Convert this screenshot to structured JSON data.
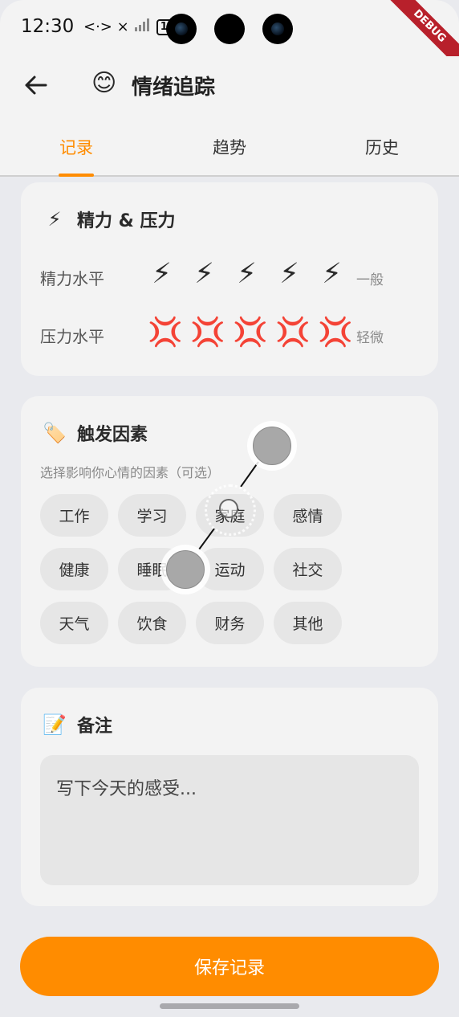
{
  "status_bar": {
    "time": "12:30",
    "network_icons": "<·> ×",
    "battery": "100"
  },
  "debug_banner": "DEBUG",
  "app_bar": {
    "title_emoji": "😊",
    "title": "情绪追踪"
  },
  "tabs": [
    {
      "label": "记录",
      "active": true
    },
    {
      "label": "趋势",
      "active": false
    },
    {
      "label": "历史",
      "active": false
    }
  ],
  "energy_stress": {
    "emoji": "⚡",
    "title": "精力 & 压力",
    "energy": {
      "label": "精力水平",
      "icon": "⚡",
      "level": 5,
      "max": 5,
      "status": "一般"
    },
    "stress": {
      "label": "压力水平",
      "icon": "💢",
      "level": 5,
      "max": 5,
      "status": "轻微"
    }
  },
  "triggers": {
    "emoji": "🏷️",
    "title": "触发因素",
    "subtitle": "选择影响你心情的因素（可选）",
    "items": [
      "工作",
      "学习",
      "家庭",
      "感情",
      "健康",
      "睡眠",
      "运动",
      "社交",
      "天气",
      "饮食",
      "财务",
      "其他"
    ]
  },
  "notes": {
    "emoji": "📝",
    "title": "备注",
    "placeholder": "写下今天的感受..."
  },
  "save_button": "保存记录",
  "colors": {
    "accent": "#ff8c00",
    "background": "#e9eaee",
    "card": "#f3f3f3",
    "chip": "#e6e6e6"
  }
}
